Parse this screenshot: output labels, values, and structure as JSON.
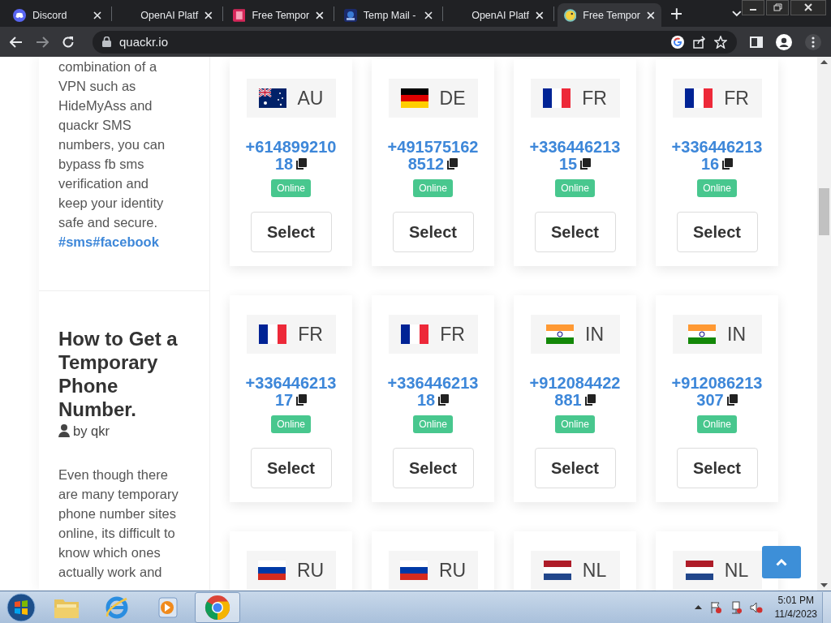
{
  "browser": {
    "tabs": [
      {
        "title": "Discord",
        "selected": false
      },
      {
        "title": "OpenAI Platf",
        "selected": false
      },
      {
        "title": "Free Tempor",
        "selected": false
      },
      {
        "title": "Temp Mail -",
        "selected": false
      },
      {
        "title": "OpenAI Platf",
        "selected": false
      },
      {
        "title": "Free Tempor",
        "selected": true
      }
    ],
    "address": "quackr.io"
  },
  "sidebar": {
    "articles": [
      {
        "body": "combination of a VPN such as HideMyAss and quackr SMS numbers, you can bypass fb sms verification and keep your identity safe and secure.",
        "tags": "#sms#facebook"
      },
      {
        "title": "How to Get a Temporary Phone Number.",
        "author": "by qkr",
        "body": "Even though there are many temporary phone number sites online, its difficult to know which ones actually work and"
      }
    ]
  },
  "numbers": [
    {
      "country": "AU",
      "number": "+61489921018",
      "status": "Online",
      "button": "Select"
    },
    {
      "country": "DE",
      "number": "+4915751628512",
      "status": "Online",
      "button": "Select"
    },
    {
      "country": "FR",
      "number": "+33644621315",
      "status": "Online",
      "button": "Select"
    },
    {
      "country": "FR",
      "number": "+33644621316",
      "status": "Online",
      "button": "Select"
    },
    {
      "country": "FR",
      "number": "+33644621317",
      "status": "Online",
      "button": "Select"
    },
    {
      "country": "FR",
      "number": "+33644621318",
      "status": "Online",
      "button": "Select"
    },
    {
      "country": "IN",
      "number": "+912084422881",
      "status": "Online",
      "button": "Select"
    },
    {
      "country": "IN",
      "number": "+912086213307",
      "status": "Online",
      "button": "Select"
    },
    {
      "country": "RU"
    },
    {
      "country": "RU"
    },
    {
      "country": "NL"
    },
    {
      "country": "NL"
    }
  ],
  "taskbar": {
    "apps": [
      {
        "selected": false
      },
      {
        "selected": false
      },
      {
        "selected": false
      },
      {
        "selected": true
      }
    ],
    "time": "5:01 PM",
    "date": "11/4/2023"
  }
}
